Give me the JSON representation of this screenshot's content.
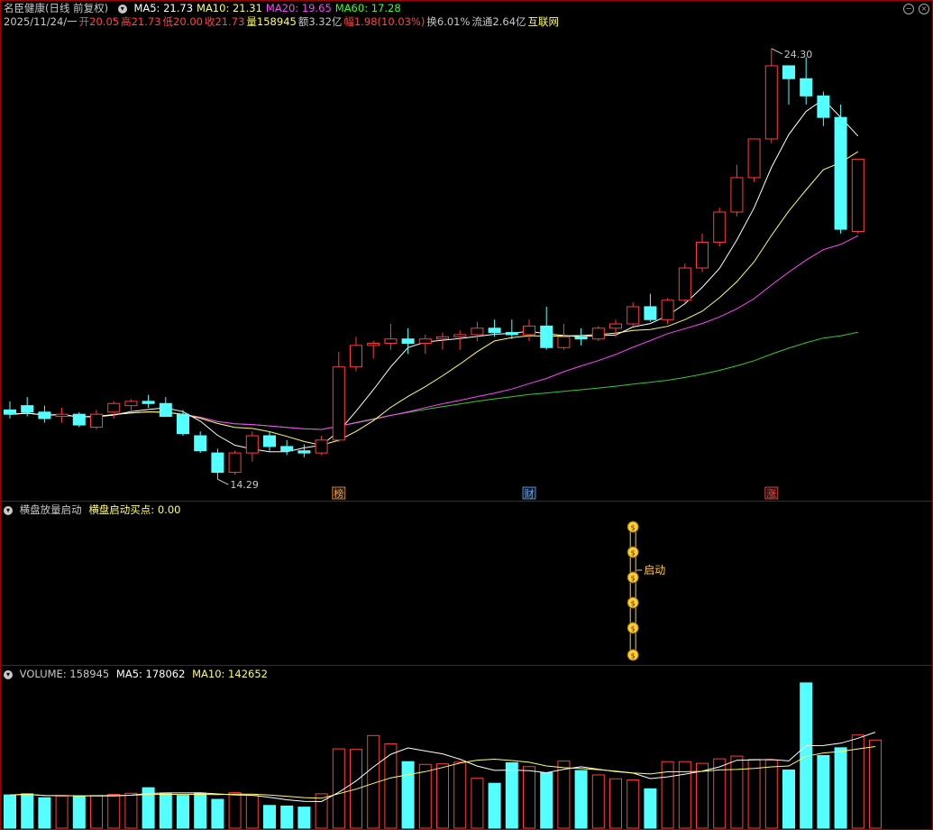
{
  "price_panel": {
    "stock_name": "名臣健康",
    "period": "(日线 前复权)",
    "date_line": "2025/11/24/一",
    "ma_labels": [
      {
        "text": "MA5: 21.73",
        "color": "#ffffff"
      },
      {
        "text": "MA10: 21.31",
        "color": "#ffff66"
      },
      {
        "text": "MA20: 19.65",
        "color": "#ff44ff"
      },
      {
        "text": "MA60: 17.28",
        "color": "#33ff33"
      }
    ],
    "quote_items": [
      {
        "text": "开20.05",
        "color": "#ff4444"
      },
      {
        "text": "高21.73",
        "color": "#ff4444"
      },
      {
        "text": "低20.00",
        "color": "#ff4444"
      },
      {
        "text": "收21.73",
        "color": "#ff4444"
      },
      {
        "text": "量158945",
        "color": "#ffff66"
      },
      {
        "text": "额3.32亿",
        "color": "#c8c8c8"
      },
      {
        "text": "幅1.98(10.03%)",
        "color": "#ff4444"
      },
      {
        "text": "换6.01%",
        "color": "#c8c8c8"
      },
      {
        "text": "流通2.64亿",
        "color": "#c8c8c8"
      },
      {
        "text": "互联网",
        "color": "#ffff66"
      }
    ],
    "high_label": "24.30",
    "low_label": "14.29",
    "event_markers": [
      {
        "text": "榜",
        "index": 19,
        "color": "#ff9933"
      },
      {
        "text": "财",
        "index": 30,
        "color": "#66aaff"
      },
      {
        "text": "涨",
        "index": 44,
        "color": "#ff4444"
      }
    ]
  },
  "indicator_panel": {
    "title": "横盘放量启动",
    "value_label": "横盘启动买点: 0.00",
    "signal_label": "启动",
    "signal_index": 36
  },
  "volume_panel": {
    "label": "VOLUME: 158945",
    "ma5_label": "MA5: 178062",
    "ma10_label": "MA10: 142652"
  },
  "colors": {
    "up": "#ff3c3c",
    "down": "#54ffff",
    "ma5": "#ffffff",
    "ma10": "#ffff66",
    "ma20": "#ff44ff",
    "ma60": "#33cc33"
  },
  "chart_data": {
    "type": "candlestick",
    "ohlc": [
      [
        15.9,
        16.1,
        15.7,
        15.8
      ],
      [
        16.0,
        16.2,
        15.75,
        15.85
      ],
      [
        15.85,
        16.0,
        15.6,
        15.7
      ],
      [
        15.75,
        15.95,
        15.6,
        15.8
      ],
      [
        15.8,
        15.85,
        15.5,
        15.55
      ],
      [
        15.5,
        15.9,
        15.45,
        15.8
      ],
      [
        15.85,
        16.1,
        15.7,
        16.05
      ],
      [
        16.0,
        16.15,
        15.85,
        16.1
      ],
      [
        16.1,
        16.25,
        15.95,
        16.05
      ],
      [
        16.05,
        16.2,
        15.8,
        15.75
      ],
      [
        15.8,
        15.9,
        15.3,
        15.35
      ],
      [
        15.3,
        15.4,
        14.9,
        14.95
      ],
      [
        14.9,
        15.0,
        14.29,
        14.45
      ],
      [
        14.45,
        14.95,
        14.4,
        14.9
      ],
      [
        14.9,
        15.4,
        14.7,
        15.3
      ],
      [
        15.3,
        15.4,
        14.95,
        15.05
      ],
      [
        15.05,
        15.2,
        14.85,
        14.95
      ],
      [
        14.95,
        15.1,
        14.8,
        14.9
      ],
      [
        14.9,
        15.3,
        14.85,
        15.2
      ],
      [
        15.2,
        17.25,
        15.15,
        16.9
      ],
      [
        16.9,
        17.6,
        16.8,
        17.4
      ],
      [
        17.4,
        17.5,
        17.1,
        17.45
      ],
      [
        17.45,
        17.9,
        17.3,
        17.55
      ],
      [
        17.55,
        17.8,
        17.2,
        17.45
      ],
      [
        17.45,
        17.65,
        17.2,
        17.55
      ],
      [
        17.55,
        17.7,
        17.3,
        17.6
      ],
      [
        17.6,
        17.75,
        17.3,
        17.65
      ],
      [
        17.65,
        17.95,
        17.5,
        17.8
      ],
      [
        17.8,
        18.0,
        17.6,
        17.7
      ],
      [
        17.7,
        18.0,
        17.55,
        17.65
      ],
      [
        17.65,
        18.0,
        17.5,
        17.85
      ],
      [
        17.85,
        18.3,
        17.3,
        17.35
      ],
      [
        17.35,
        17.9,
        17.3,
        17.6
      ],
      [
        17.6,
        17.8,
        17.4,
        17.55
      ],
      [
        17.55,
        17.85,
        17.5,
        17.8
      ],
      [
        17.8,
        18.0,
        17.6,
        17.9
      ],
      [
        17.9,
        18.4,
        17.85,
        18.3
      ],
      [
        18.3,
        18.6,
        17.95,
        18.0
      ],
      [
        18.0,
        18.5,
        17.9,
        18.45
      ],
      [
        18.45,
        19.3,
        18.4,
        19.2
      ],
      [
        19.2,
        20.0,
        19.1,
        19.8
      ],
      [
        19.8,
        20.6,
        19.7,
        20.5
      ],
      [
        20.5,
        21.6,
        20.4,
        21.3
      ],
      [
        21.3,
        22.1,
        21.2,
        22.2
      ],
      [
        22.2,
        24.3,
        22.1,
        23.9
      ],
      [
        23.9,
        23.9,
        23.0,
        23.6
      ],
      [
        23.6,
        24.1,
        23.0,
        23.2
      ],
      [
        23.2,
        23.3,
        22.5,
        22.7
      ],
      [
        22.7,
        23.0,
        20.0,
        20.1
      ],
      [
        20.05,
        21.73,
        20.0,
        21.73
      ]
    ],
    "volume": [
      60000,
      62000,
      55000,
      58000,
      57000,
      59000,
      61000,
      63000,
      73000,
      62000,
      59000,
      63000,
      52000,
      64000,
      59000,
      41000,
      40000,
      38000,
      62000,
      143000,
      142000,
      167000,
      152000,
      120000,
      115000,
      116000,
      119000,
      90000,
      81000,
      118000,
      111000,
      100000,
      121000,
      104000,
      96000,
      89000,
      87000,
      71000,
      120000,
      120000,
      117000,
      125000,
      130000,
      124000,
      123000,
      105000,
      262000,
      131000,
      145000,
      168000,
      158945
    ],
    "ylim": [
      14.0,
      24.8
    ],
    "volume_ylim": [
      0,
      270000
    ]
  }
}
